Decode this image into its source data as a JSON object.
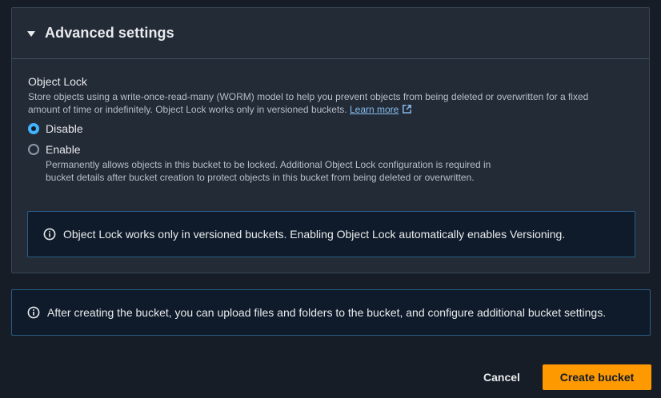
{
  "advanced_settings": {
    "title": "Advanced settings",
    "object_lock": {
      "label": "Object Lock",
      "description": "Store objects using a write-once-read-many (WORM) model to help you prevent objects from being deleted or overwritten for a fixed amount of time or indefinitely. Object Lock works only in versioned buckets.",
      "learn_more": "Learn more",
      "options": [
        {
          "label": "Disable",
          "checked": true,
          "description": ""
        },
        {
          "label": "Enable",
          "checked": false,
          "description": "Permanently allows objects in this bucket to be locked. Additional Object Lock configuration is required in bucket details after bucket creation to protect objects in this bucket from being deleted or overwritten."
        }
      ],
      "alert": "Object Lock works only in versioned buckets. Enabling Object Lock automatically enables Versioning."
    }
  },
  "footer_alert": "After creating the bucket, you can upload files and folders to the bucket, and configure additional bucket settings.",
  "actions": {
    "cancel": "Cancel",
    "create": "Create bucket"
  },
  "colors": {
    "background": "#161d26",
    "panel": "#232b37",
    "accent_radio": "#42b4ff",
    "link": "#89bdee",
    "primary_button": "#ff9900",
    "alert_border": "#2c5d86"
  },
  "icons": {
    "expand": "caret-down-icon",
    "external": "external-link-icon",
    "info": "info-icon"
  }
}
